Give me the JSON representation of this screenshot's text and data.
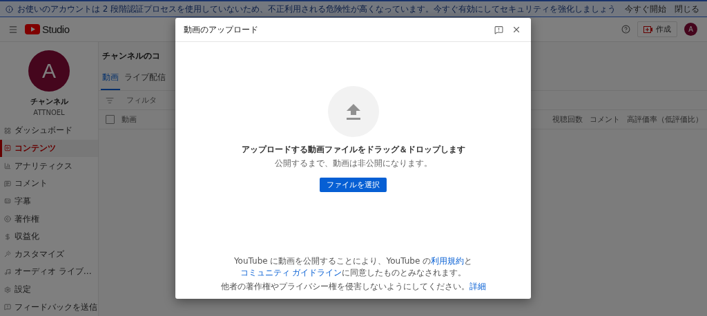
{
  "banner": {
    "text": "お使いのアカウントは 2 段階認証プロセスを使用していないため、不正利用される危険性が高くなっています。今すぐ有効にしてセキュリティを強化しましょう",
    "actions": [
      "今すぐ開始",
      "閉じる"
    ]
  },
  "header": {
    "logo_text": "Studio",
    "create_label": "作成",
    "avatar_letter": "A"
  },
  "sidebar": {
    "avatar_letter": "A",
    "channel_name": "チャンネル",
    "handle": "ATTNOEL",
    "items": [
      {
        "label": "ダッシュボード",
        "selected": false
      },
      {
        "label": "コンテンツ",
        "selected": true
      },
      {
        "label": "アナリティクス",
        "selected": false
      },
      {
        "label": "コメント",
        "selected": false
      },
      {
        "label": "字幕",
        "selected": false
      },
      {
        "label": "著作権",
        "selected": false
      },
      {
        "label": "収益化",
        "selected": false
      },
      {
        "label": "カスタマイズ",
        "selected": false
      },
      {
        "label": "オーディオ ライブ…",
        "selected": false
      },
      {
        "label": "設定",
        "selected": false
      },
      {
        "label": "フィードバックを送信",
        "selected": false
      }
    ]
  },
  "main": {
    "title": "チャンネルのコ",
    "tabs": [
      {
        "label": "動画",
        "selected": true
      },
      {
        "label": "ライブ配信",
        "selected": false
      }
    ],
    "filter_placeholder": "フィルタ",
    "select_all_checked": false,
    "columns": [
      "動画",
      "視聴回数",
      "コメント",
      "高評価率（低評価比）"
    ]
  },
  "dialog": {
    "title": "動画のアップロード",
    "heading": "アップロードする動画ファイルをドラッグ＆ドロップします",
    "subtext": "公開するまで、動画は非公開になります。",
    "button": "ファイルを選択",
    "terms": [
      [
        {
          "kind": "text",
          "text": "YouTube に動画を公開することにより、YouTube の"
        },
        {
          "kind": "link",
          "text": "利用規約"
        },
        {
          "kind": "text",
          "text": "と"
        },
        {
          "kind": "link",
          "text": "コミュニティ ガイドライン"
        },
        {
          "kind": "text",
          "text": "に同意したものとみなされます。"
        }
      ],
      [
        {
          "kind": "text",
          "text": "他者の著作権やプライバシー権を侵害しないようにしてください。"
        },
        {
          "kind": "link",
          "text": "詳細"
        }
      ]
    ]
  }
}
